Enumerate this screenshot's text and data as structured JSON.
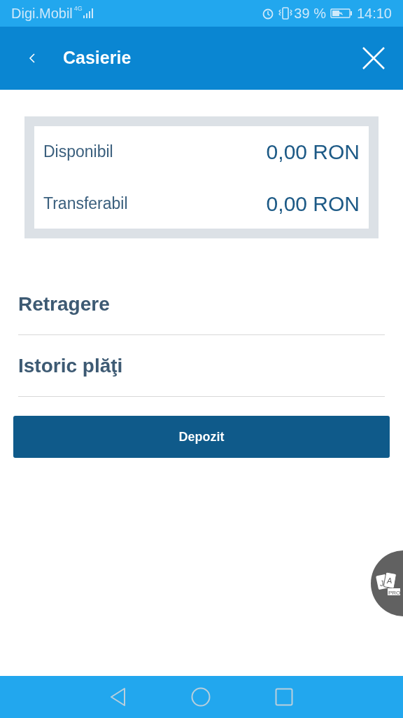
{
  "status_bar": {
    "carrier": "Digi.Mobil",
    "network": "4G",
    "battery": "39 %",
    "time": "14:10"
  },
  "header": {
    "title": "Casierie"
  },
  "balances": [
    {
      "label": "Disponibil",
      "value": "0,00 RON"
    },
    {
      "label": "Transferabil",
      "value": "0,00 RON"
    }
  ],
  "menu": [
    "Retragere",
    "Istoric plăţi"
  ],
  "deposit_button": "Depozit",
  "floating_badge": {
    "cards": [
      "J",
      "A"
    ],
    "tag": "PRO"
  }
}
